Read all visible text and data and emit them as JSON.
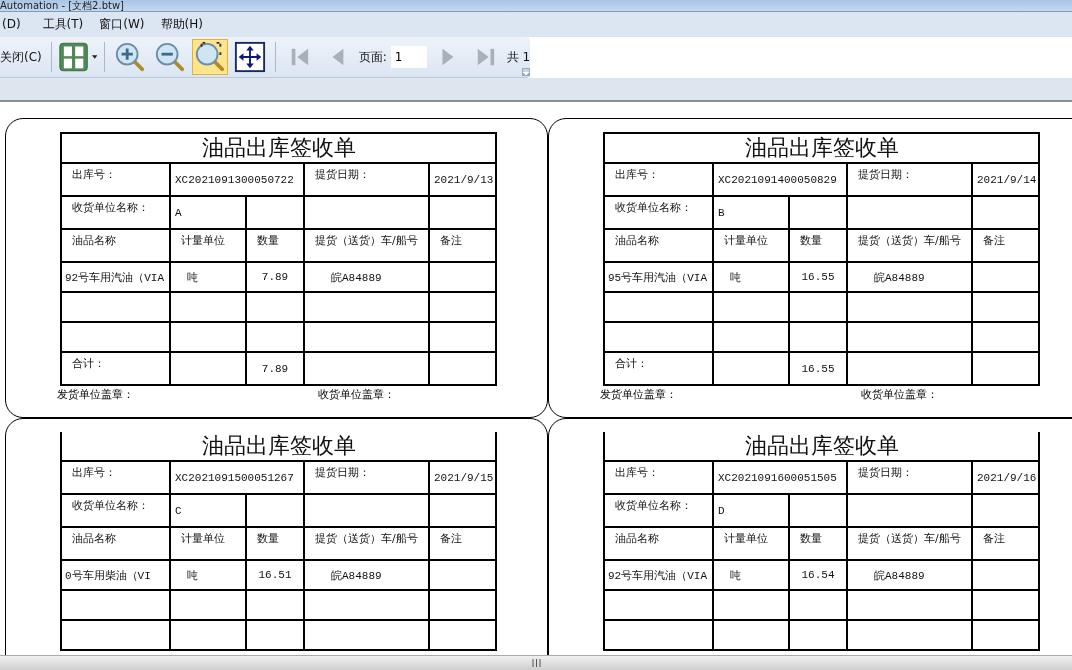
{
  "window": {
    "title": "Automation - [文档2.btw]"
  },
  "menu": [
    {
      "label": "(D)"
    },
    {
      "label": "工具(T)"
    },
    {
      "label": "窗口(W)"
    },
    {
      "label": "帮助(H)"
    }
  ],
  "toolbar": {
    "close": "关闭(C)",
    "zoom_buttons": [
      {
        "kind": "zoom-in",
        "selected": false
      },
      {
        "kind": "zoom-out",
        "selected": false
      },
      {
        "kind": "zoom-window",
        "selected": true
      },
      {
        "kind": "fit",
        "selected": false
      }
    ],
    "page_label": "页面:",
    "page_value": "1",
    "page_total": "共 1"
  },
  "labels": [
    {
      "title": "油品出库签收单",
      "no_label": "出库号：",
      "no": "XC2021091300050722",
      "date_label": "提货日期：",
      "date": "2021/9/13",
      "consignee_label": "收货单位名称：",
      "consignee": "A",
      "columns": [
        "油品名称",
        "计量单位",
        "数量",
        "提货（送货）车/船号",
        "备注"
      ],
      "item": {
        "product": "92号车用汽油（VIA",
        "unit": "吨",
        "qty": "7.89",
        "vehicle": "皖A84889"
      },
      "total_label": "合计：",
      "total_qty": "7.89",
      "stamps": [
        "发货单位盖章：",
        "收货单位盖章："
      ]
    },
    {
      "title": "油品出库签收单",
      "no_label": "出库号：",
      "no": "XC2021091400050829",
      "date_label": "提货日期：",
      "date": "2021/9/14",
      "consignee_label": "收货单位名称：",
      "consignee": "B",
      "columns": [
        "油品名称",
        "计量单位",
        "数量",
        "提货（送货）车/船号",
        "备注"
      ],
      "item": {
        "product": "95号车用汽油（VIA",
        "unit": "吨",
        "qty": "16.55",
        "vehicle": "皖A84889"
      },
      "total_label": "合计：",
      "total_qty": "16.55",
      "stamps": [
        "发货单位盖章：",
        "收货单位盖章："
      ]
    },
    {
      "title": "油品出库签收单",
      "no_label": "出库号：",
      "no": "XC2021091500051267",
      "date_label": "提货日期：",
      "date": "2021/9/15",
      "consignee_label": "收货单位名称：",
      "consignee": "C",
      "columns": [
        "油品名称",
        "计量单位",
        "数量",
        "提货（送货）车/船号",
        "备注"
      ],
      "item": {
        "product": "0号车用柴油（VI",
        "unit": "吨",
        "qty": "16.51",
        "vehicle": "皖A84889"
      }
    },
    {
      "title": "油品出库签收单",
      "no_label": "出库号：",
      "no": "XC2021091600051505",
      "date_label": "提货日期：",
      "date": "2021/9/16",
      "consignee_label": "收货单位名称：",
      "consignee": "D",
      "columns": [
        "油品名称",
        "计量单位",
        "数量",
        "提货（送货）车/船号",
        "备注"
      ],
      "item": {
        "product": "92号车用汽油（VIA",
        "unit": "吨",
        "qty": "16.54",
        "vehicle": "皖A84889"
      }
    }
  ]
}
